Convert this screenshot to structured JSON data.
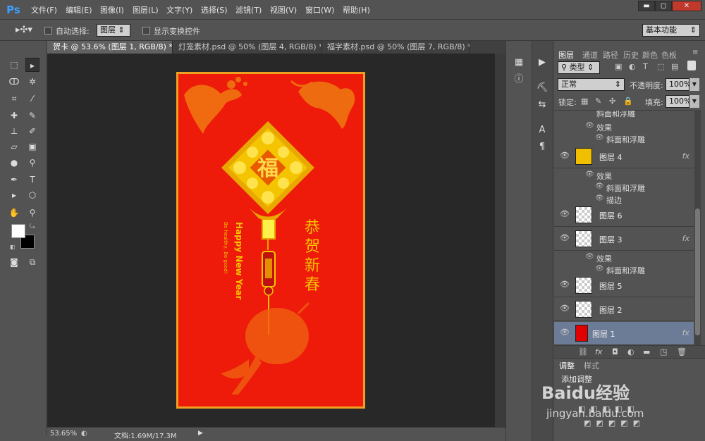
{
  "menubar": {
    "logo": "Ps",
    "items": [
      "文件(F)",
      "编辑(E)",
      "图像(I)",
      "图层(L)",
      "文字(Y)",
      "选择(S)",
      "滤镜(T)",
      "视图(V)",
      "窗口(W)",
      "帮助(H)"
    ],
    "window_controls": [
      "▬",
      "◻",
      "✕"
    ]
  },
  "options": {
    "auto_select_label": "自动选择:",
    "auto_select_value": "图层",
    "show_transform_label": "显示变换控件",
    "workspace_value": "基本功能"
  },
  "tabs": [
    {
      "label": "贺卡 @ 53.6% (图层 1, RGB/8) *"
    },
    {
      "label": "灯笼素材.psd @ 50% (图层 4, RGB/8) *"
    },
    {
      "label": "福字素材.psd @ 50% (图层 7, RGB/8) *"
    }
  ],
  "card": {
    "fu": "福",
    "greeting_cn": [
      "恭",
      "贺",
      "新",
      "春"
    ],
    "happy_new_year": "Happy New Year",
    "small_text": "Be healthy, Be good!"
  },
  "statusbar": {
    "zoom": "53.65%",
    "doc_info": "文档:1.69M/17.3M"
  },
  "layers_panel": {
    "tabs": [
      "图层",
      "通道",
      "路径",
      "历史",
      "颜色",
      "色板"
    ],
    "filter_kind": "类型",
    "blend_mode": "正常",
    "opacity_label": "不透明度:",
    "opacity_value": "100%",
    "lock_label": "锁定:",
    "fill_label": "填充:",
    "fill_value": "100%",
    "truncated_top": "斜面和浮雕",
    "effects_label": "效果",
    "bevel_emboss": "斜面和浮雕",
    "stroke": "描边",
    "layers": [
      {
        "name": "图层 4",
        "fx": "fx",
        "thumb_color": "#f0c000"
      },
      {
        "name": "图层 6",
        "fx": "",
        "thumb_color": "#f8e010"
      },
      {
        "name": "图层 3",
        "fx": "fx",
        "thumb_color": "#f3d040"
      },
      {
        "name": "图层 5",
        "fx": "",
        "thumb_color": "#f0d060"
      },
      {
        "name": "图层 2",
        "fx": "",
        "thumb_color": "#f0c050"
      },
      {
        "name": "图层 1",
        "fx": "fx",
        "thumb_color": "#e00000"
      }
    ]
  },
  "adjust_panel": {
    "tabs": [
      "调整",
      "样式"
    ],
    "add_label": "添加调整"
  },
  "watermark": {
    "brand": "Baidu经验",
    "url": "jingyan.baidu.com"
  },
  "colors": {
    "card_red": "#ee1a0a",
    "gold": "#f5c400",
    "border_gold": "#f0a020",
    "selected_layer": "#6d7c96"
  }
}
